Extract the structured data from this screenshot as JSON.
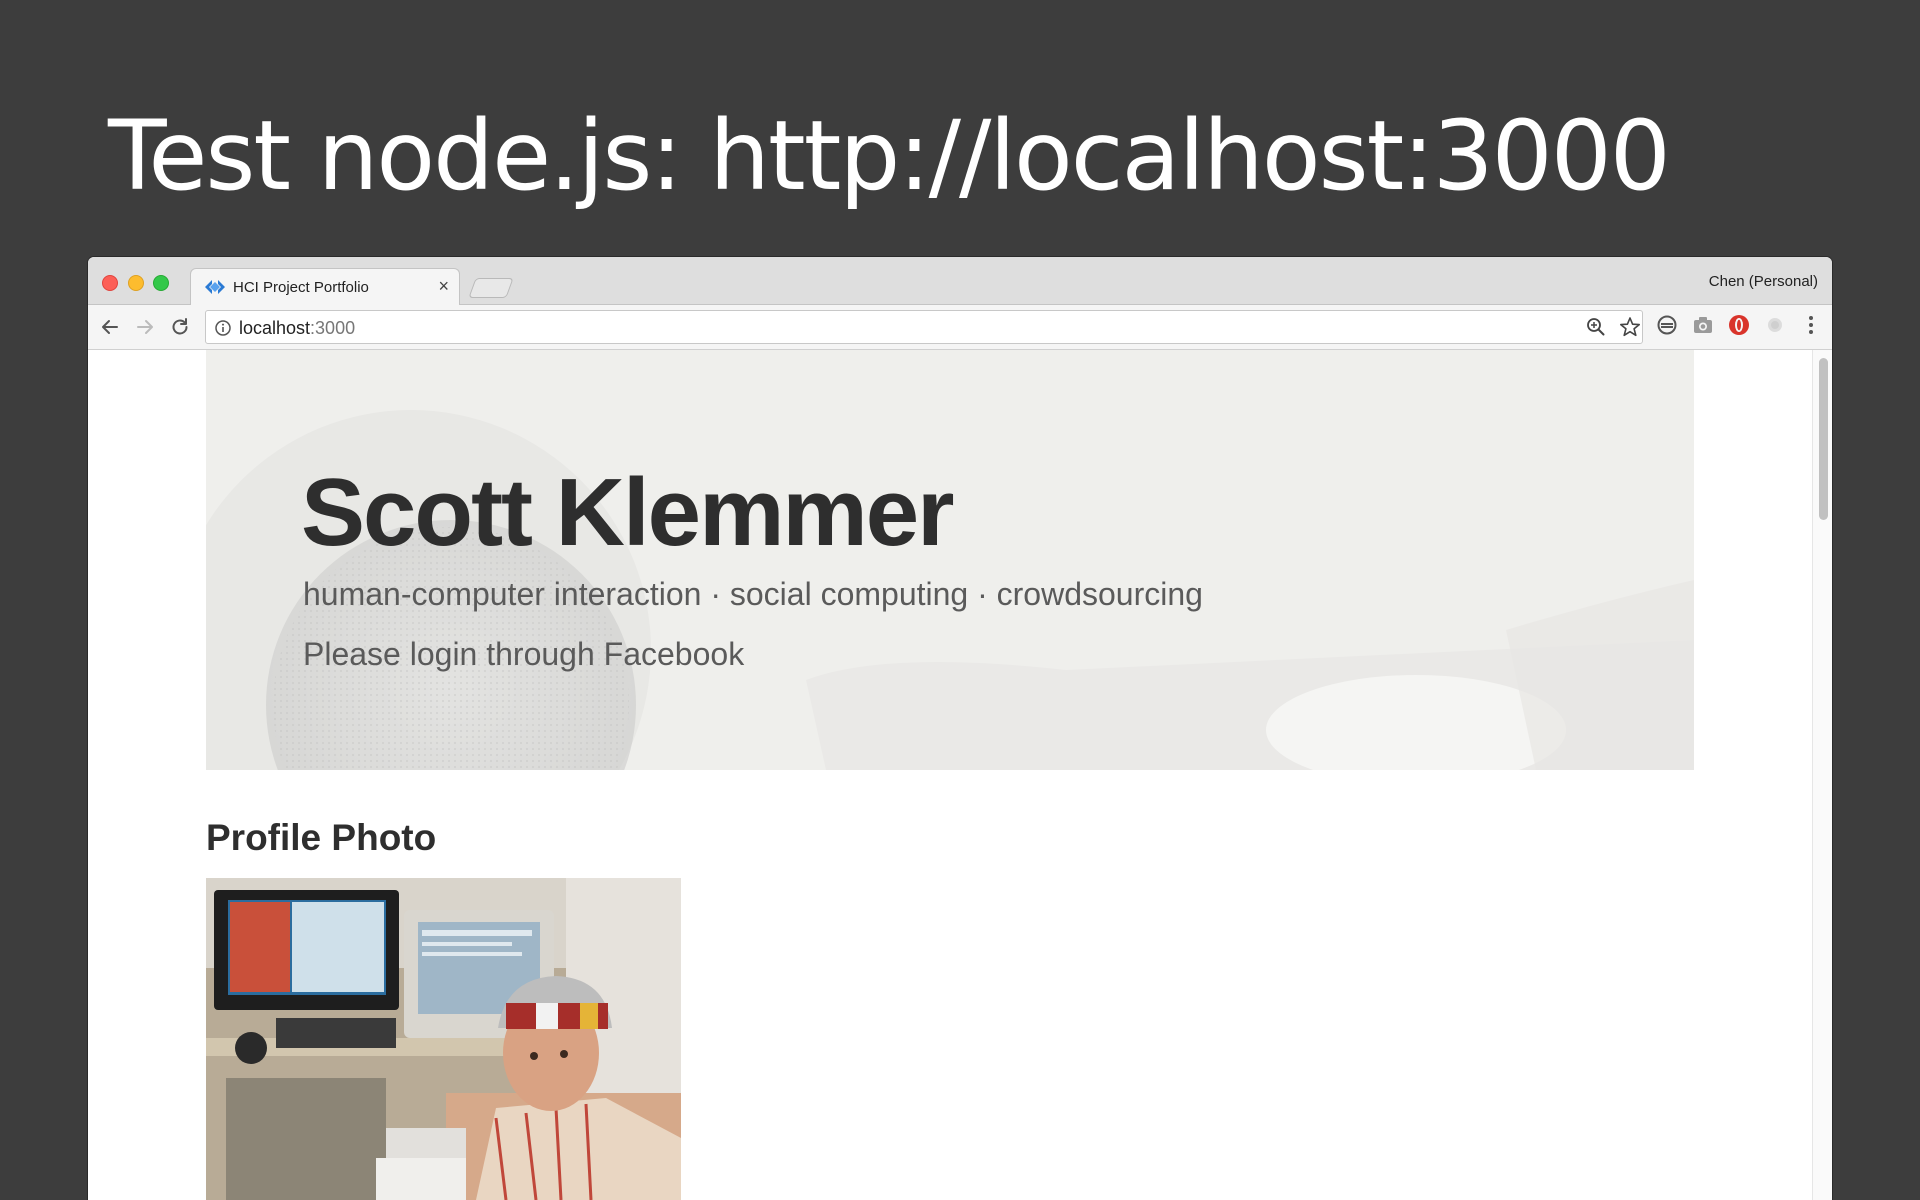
{
  "slide": {
    "title": "Test node.js: http://localhost:3000"
  },
  "browser": {
    "tab": {
      "title": "HCI Project Portfolio",
      "close_glyph": "×",
      "favicon": "diamond-arrows-icon"
    },
    "profile_label": "Chen (Personal)",
    "address": {
      "host": "localhost",
      "port": ":3000"
    },
    "icons": {
      "back": "back-arrow-icon",
      "forward": "forward-arrow-icon",
      "reload": "reload-icon",
      "info": "info-icon",
      "zoom": "zoom-icon",
      "bookmark": "star-icon"
    },
    "colors": {
      "close": "#fc5f57",
      "minimize": "#fdbc2e",
      "maximize": "#34c84a",
      "extension_red": "#d9342b"
    }
  },
  "page": {
    "hero": {
      "name": "Scott Klemmer",
      "tagline": "human-computer interaction · social computing · crowdsourcing",
      "login_prompt": "Please login through Facebook"
    },
    "profile_section": {
      "heading": "Profile Photo"
    }
  }
}
